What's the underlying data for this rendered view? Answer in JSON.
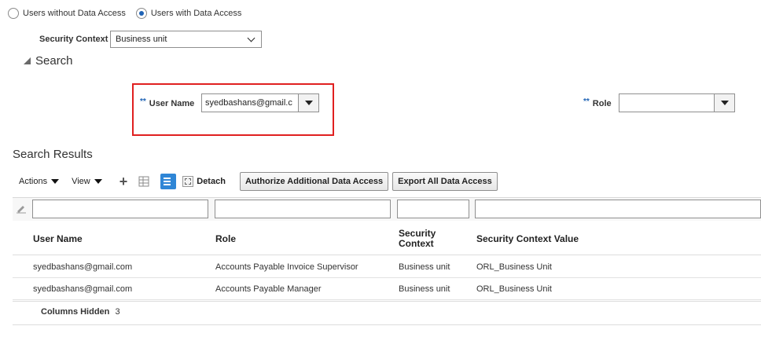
{
  "access_filter": {
    "options": [
      {
        "label": "Users without Data Access",
        "selected": false
      },
      {
        "label": "Users with Data Access",
        "selected": true
      }
    ]
  },
  "security_context": {
    "label": "Security Context",
    "value": "Business unit"
  },
  "search": {
    "heading": "Search",
    "required_marker": "**",
    "user_name": {
      "label": "User Name",
      "value": "syedbashans@gmail.c"
    },
    "role": {
      "label": "Role",
      "value": ""
    }
  },
  "results": {
    "heading": "Search Results",
    "toolbar": {
      "actions_label": "Actions",
      "view_label": "View",
      "detach_label": "Detach",
      "authorize_label": "Authorize Additional Data Access",
      "export_label": "Export All Data Access"
    },
    "columns": [
      "User Name",
      "Role",
      "Security Context",
      "Security Context Value"
    ],
    "rows": [
      [
        "syedbashans@gmail.com",
        "Accounts Payable Invoice Supervisor",
        "Business unit",
        "ORL_Business Unit"
      ],
      [
        "syedbashans@gmail.com",
        "Accounts Payable Manager",
        "Business unit",
        "ORL_Business Unit"
      ]
    ],
    "columns_hidden_label": "Columns Hidden",
    "columns_hidden_count": "3"
  },
  "colors": {
    "accent": "#1f63b5",
    "highlight_box": "#e02020",
    "freeze_icon": "#2f86d6"
  }
}
